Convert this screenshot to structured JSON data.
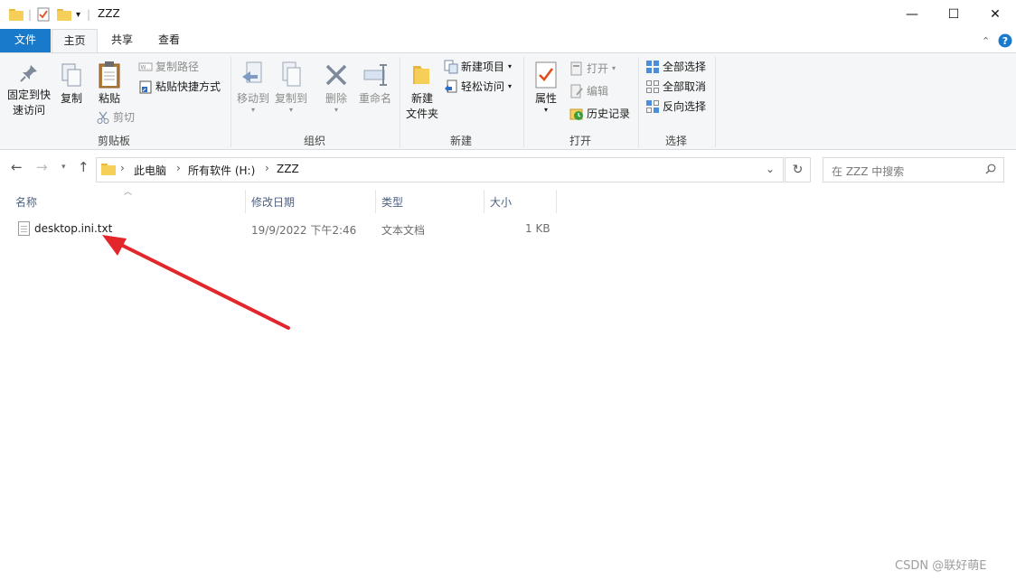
{
  "window": {
    "title": "ZZZ",
    "controls": {
      "minimize": "—",
      "maximize": "☐",
      "close": "✕"
    }
  },
  "tabs": [
    {
      "label": "文件"
    },
    {
      "label": "主页"
    },
    {
      "label": "共享"
    },
    {
      "label": "查看"
    }
  ],
  "ribbon": {
    "clipboard": {
      "pin_label_1": "固定到快",
      "pin_label_2": "速访问",
      "copy": "复制",
      "paste": "粘贴",
      "copy_path": "复制路径",
      "paste_shortcut": "粘贴快捷方式",
      "cut": "剪切",
      "group": "剪贴板"
    },
    "organize": {
      "move_to": "移动到",
      "copy_to": "复制到",
      "delete": "删除",
      "rename": "重命名",
      "group": "组织"
    },
    "new": {
      "new_folder_1": "新建",
      "new_folder_2": "文件夹",
      "new_item": "新建项目",
      "easy_access": "轻松访问",
      "group": "新建"
    },
    "open": {
      "properties": "属性",
      "open": "打开",
      "edit": "编辑",
      "history": "历史记录",
      "group": "打开"
    },
    "select": {
      "select_all": "全部选择",
      "select_none": "全部取消",
      "invert": "反向选择",
      "group": "选择"
    }
  },
  "address": {
    "parts": [
      "此电脑",
      "所有软件 (H:)",
      "ZZZ"
    ],
    "search_placeholder": "在 ZZZ 中搜索"
  },
  "columns": {
    "name": "名称",
    "modified": "修改日期",
    "type": "类型",
    "size": "大小"
  },
  "files": [
    {
      "name": "desktop.ini.txt",
      "modified": "19/9/2022 下午2:46",
      "type": "文本文档",
      "size": "1 KB"
    }
  ],
  "watermark": "CSDN @联好萌E",
  "colors": {
    "accent": "#1979ca",
    "annotation_arrow": "#e3262b"
  }
}
